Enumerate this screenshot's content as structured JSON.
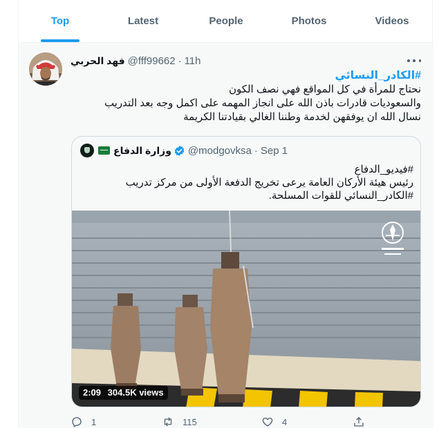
{
  "tabs": [
    {
      "label": "Top",
      "active": true
    },
    {
      "label": "Latest",
      "active": false
    },
    {
      "label": "People",
      "active": false
    },
    {
      "label": "Photos",
      "active": false
    },
    {
      "label": "Videos",
      "active": false
    }
  ],
  "tweet": {
    "name": "فهد الحربي",
    "handle": "@fff99662",
    "separator": "·",
    "time": "11h",
    "hashtag": "#الكادر_النسائي",
    "lines": [
      "نحتاج للمرأة في كل المواقع فهي نصف الكون",
      "والسعوديات قادرات باذن الله على انجاز المهمه على اكمل وجه بعد التدريب",
      "نسال الله ان يوفقهن لخدمة وطننا الغالي بقيادتنا الكريمة"
    ],
    "quoted": {
      "name": "وزارة الدفاع",
      "handle": "@modgovksa",
      "separator": "·",
      "time": "Sep 1",
      "lines": [
        "#فيديو_الدفاع",
        "رئيس هيئة الأركان العامة يرعى تخريج الدفعة الأولى من مركز تدريب",
        "#الكادر_النسائي للقوات المسلحة."
      ],
      "video": {
        "duration": "2:09",
        "views": "304.5K views"
      }
    },
    "actions": {
      "replies": "1",
      "retweets": "115",
      "likes": "4"
    }
  },
  "colors": {
    "accent": "#1d9bf0",
    "muted": "#536471",
    "border": "#cfd9de"
  },
  "icons": [
    "reply-icon",
    "retweet-icon",
    "like-icon",
    "share-icon",
    "verified-badge-icon",
    "more-icon"
  ]
}
